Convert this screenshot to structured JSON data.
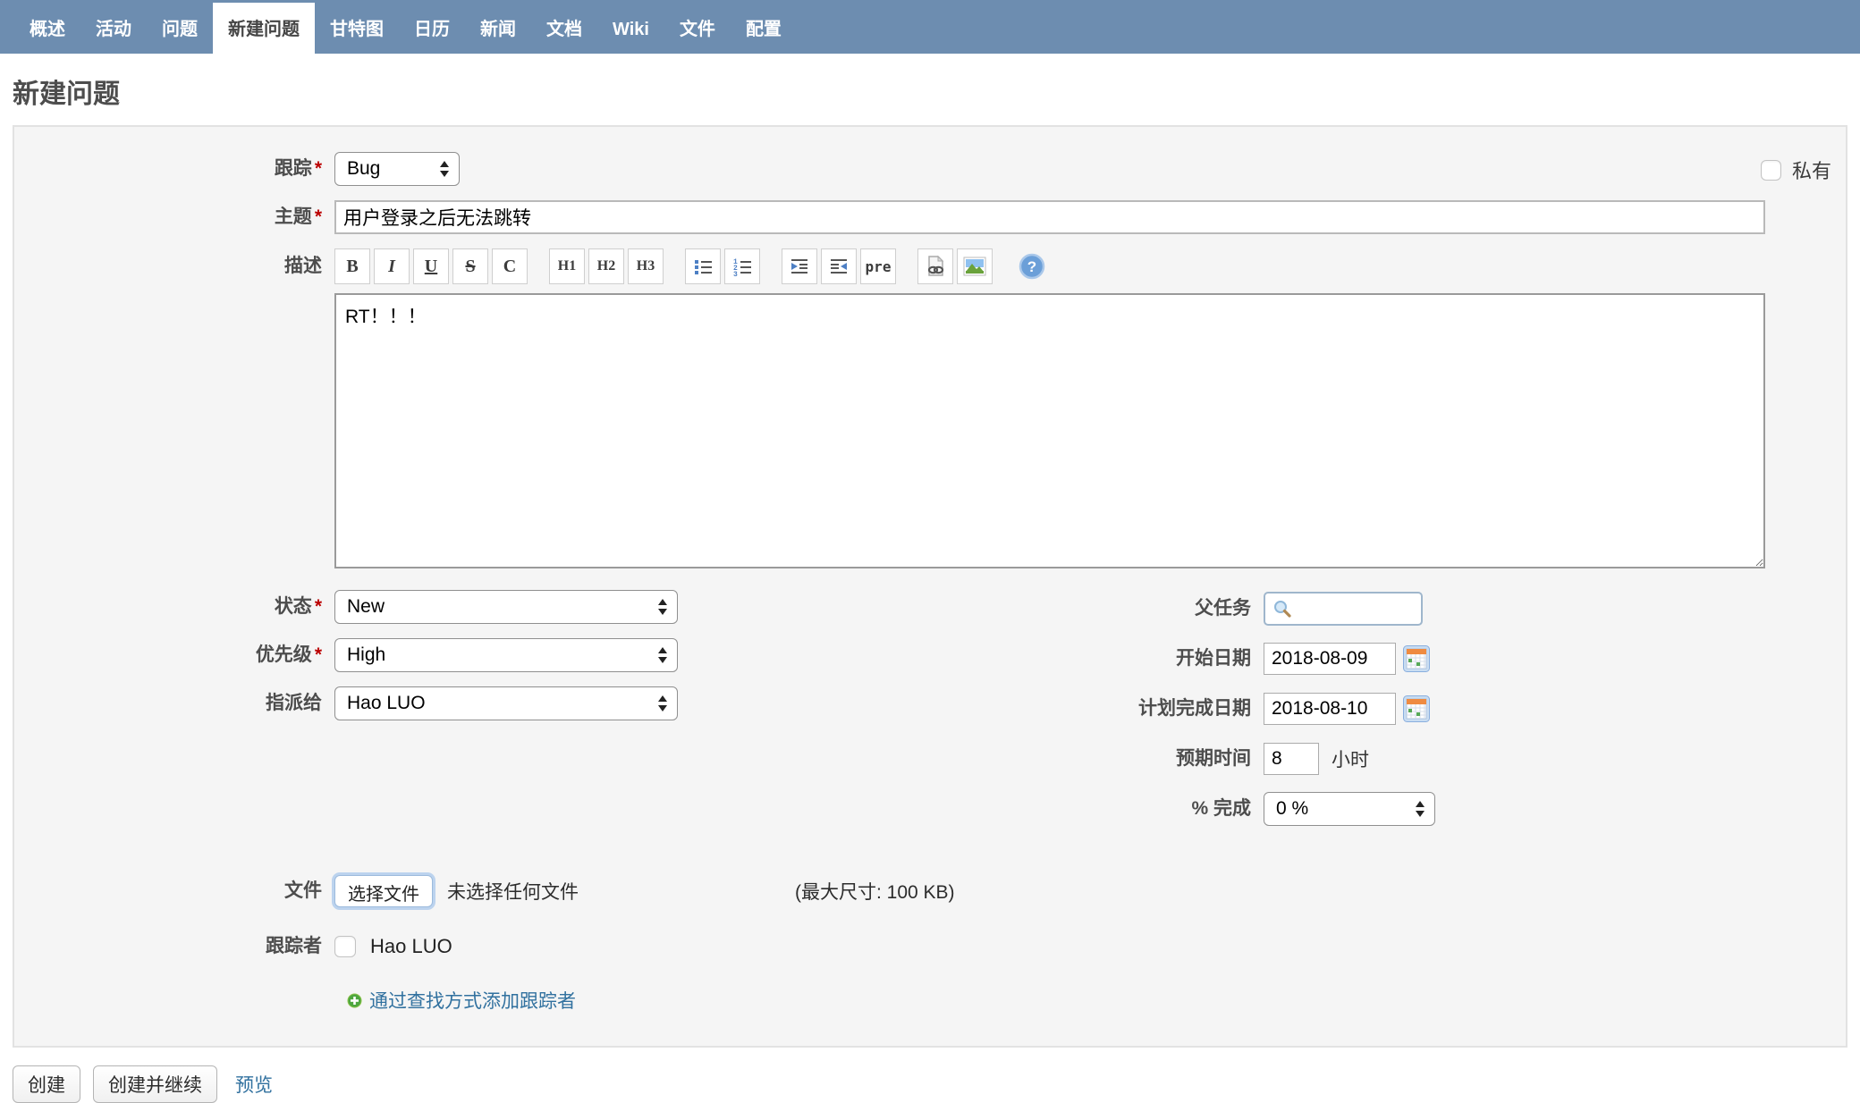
{
  "meta": {
    "required_mark": "*"
  },
  "nav": {
    "tabs": [
      "概述",
      "活动",
      "问题",
      "新建问题",
      "甘特图",
      "日历",
      "新闻",
      "文档",
      "Wiki",
      "文件",
      "配置"
    ],
    "active": "新建问题"
  },
  "page_title": "新建问题",
  "form": {
    "tracker": {
      "label": "跟踪",
      "value": "Bug"
    },
    "private_label": "私有",
    "subject": {
      "label": "主题",
      "value": "用户登录之后无法跳转"
    },
    "description": {
      "label": "描述",
      "value": "RT！！！"
    },
    "toolbar": {
      "bold": "B",
      "italic": "I",
      "underline": "U",
      "strike": "S",
      "code": "C",
      "h1": "H1",
      "h2": "H2",
      "h3": "H3",
      "pre": "pre",
      "icon_names": [
        "unordered-list",
        "ordered-list",
        "indent-right",
        "indent-left",
        "link",
        "image",
        "help"
      ]
    },
    "status": {
      "label": "状态",
      "value": "New"
    },
    "priority": {
      "label": "优先级",
      "value": "High"
    },
    "assignee": {
      "label": "指派给",
      "value": "Hao LUO"
    },
    "parent_task": {
      "label": "父任务",
      "value": ""
    },
    "start_date": {
      "label": "开始日期",
      "value": "2018-08-09"
    },
    "due_date": {
      "label": "计划完成日期",
      "value": "2018-08-10"
    },
    "estimated_time": {
      "label": "预期时间",
      "value": "8",
      "unit": "小时"
    },
    "done_ratio": {
      "label": "% 完成",
      "value": "0 %"
    },
    "files": {
      "label": "文件",
      "choose_button": "选择文件",
      "no_file_text": "未选择任何文件",
      "max_size_text": "(最大尺寸: 100 KB)"
    },
    "watchers": {
      "label": "跟踪者",
      "candidates": [
        {
          "name": "Hao LUO",
          "checked": false
        }
      ],
      "add_link": "通过查找方式添加跟踪者"
    }
  },
  "actions": {
    "create": "创建",
    "create_and_continue": "创建并继续",
    "preview": "预览"
  },
  "colors": {
    "nav_bg": "#6d8db0",
    "link": "#31719f",
    "label_text": "#4d4d4d",
    "required": "#bb0000",
    "box_bg": "#f5f5f5",
    "box_border": "#e2e2e2"
  }
}
